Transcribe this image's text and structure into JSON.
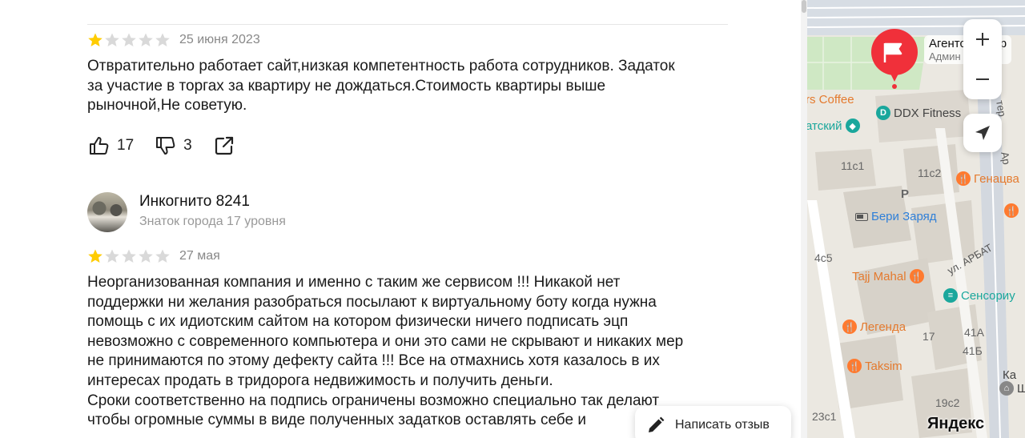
{
  "reviews": [
    {
      "rating": 1,
      "date": "25 июня 2023",
      "text_lines": [
        "Отвратительно работает сайт,низкая компетентность работа сотрудников. Задаток",
        "за участие в торгах за квартиру не дождаться.Стоимость квартиры выше",
        "рыночной,Не советую."
      ],
      "likes": "17",
      "dislikes": "3"
    },
    {
      "author": "Инкогнито 8241",
      "level": "Знаток города 17 уровня",
      "rating": 1,
      "date": "27 мая",
      "text_lines": [
        "Неорганизованная компания и именно с таким же сервисом !!! Никакой нет",
        "поддержки ни желания разобраться посылают к виртуальному боту когда нужна",
        "помощь с их идиотским сайтом на котором физически ничего подписать эцп",
        "невозможно с современного компьютера и они это сами не скрывают и никаких мер",
        "не принимаются по этому дефекту сайта !!! Все на отмахнись хотя казалось в их",
        "интересах продать в тридорога недвижимость и получить деньги.",
        "Сроки соответственно на подпись ограничены возможно специально так делают",
        "чтобы огромные суммы в виде полученных задатков оставлять себе и"
      ]
    }
  ],
  "write_review_label": "Написать отзыв",
  "map": {
    "org_name": "Агентство упр",
    "org_sub": "Админ",
    "labels": {
      "coffee": "rs Coffee",
      "ddx": "DDX Fitness",
      "atsky": "атский",
      "b11c1": "11с1",
      "b11c2": "11с2",
      "parking": "P",
      "genatsva": "Генацва",
      "beri": "Бери Заряд",
      "b4c5": "4с5",
      "arbat": "ул. АРБАТ",
      "tajj": "Tajj Mahal",
      "sensoriu": "Сенсориу",
      "legenda": "Легенда",
      "b17": "17",
      "b41a": "41А",
      "b41b": "41Б",
      "taksim": "Taksim",
      "ka": "Ка",
      "sh": "Ш",
      "b19c2": "19с2",
      "b23c1": "23с1",
      "ter": "тер",
      "ar": "Ар"
    },
    "logo": "Яндекс",
    "zoom_in": "+",
    "zoom_out": "−"
  },
  "colors": {
    "star_on": "#fc0",
    "star_off": "#d9d9d9",
    "pin": "#f0303a",
    "poi_orange": "#ff7a2f",
    "poi_teal": "#1aa79c",
    "poi_blue": "#2f7fd8"
  },
  "icons": [
    "thumbs-up-icon",
    "thumbs-down-icon",
    "share-icon",
    "pencil-icon",
    "plus-icon",
    "minus-icon",
    "location-arrow-icon",
    "flag-icon"
  ]
}
